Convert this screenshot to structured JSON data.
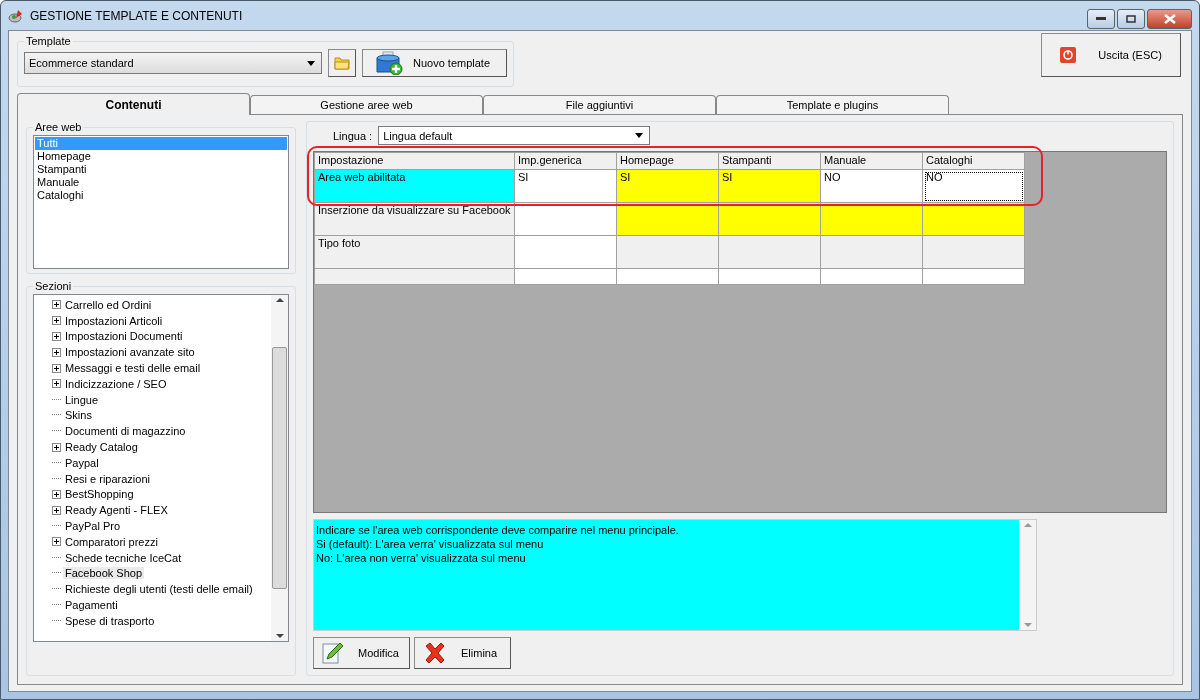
{
  "window": {
    "title": "GESTIONE TEMPLATE E CONTENUTI"
  },
  "template": {
    "label": "Template",
    "value": "Ecommerce standard",
    "new_button": "Nuovo template"
  },
  "exit_button": "Uscita (ESC)",
  "tabs": [
    {
      "label": "Contenuti",
      "selected": true
    },
    {
      "label": "Gestione aree web",
      "selected": false
    },
    {
      "label": "File aggiuntivi",
      "selected": false
    },
    {
      "label": "Template e plugins",
      "selected": false
    }
  ],
  "aree_web": {
    "label": "Aree web",
    "items": [
      {
        "label": "Tutti",
        "selected": true
      },
      {
        "label": "Homepage",
        "selected": false
      },
      {
        "label": "Stampanti",
        "selected": false
      },
      {
        "label": "Manuale",
        "selected": false
      },
      {
        "label": "Cataloghi",
        "selected": false
      }
    ]
  },
  "sezioni": {
    "label": "Sezioni",
    "items": [
      {
        "label": "Carrello ed Ordini",
        "expandable": true,
        "selected": false
      },
      {
        "label": "Impostazioni Articoli",
        "expandable": true,
        "selected": false
      },
      {
        "label": "Impostazioni Documenti",
        "expandable": true,
        "selected": false
      },
      {
        "label": "Impostazioni avanzate sito",
        "expandable": true,
        "selected": false
      },
      {
        "label": "Messaggi e testi delle email",
        "expandable": true,
        "selected": false
      },
      {
        "label": "Indicizzazione / SEO",
        "expandable": true,
        "selected": false
      },
      {
        "label": "Lingue",
        "expandable": false,
        "selected": false
      },
      {
        "label": "Skins",
        "expandable": false,
        "selected": false
      },
      {
        "label": "Documenti di magazzino",
        "expandable": false,
        "selected": false
      },
      {
        "label": "Ready Catalog",
        "expandable": true,
        "selected": false
      },
      {
        "label": "Paypal",
        "expandable": false,
        "selected": false
      },
      {
        "label": "Resi e riparazioni",
        "expandable": false,
        "selected": false
      },
      {
        "label": "BestShopping",
        "expandable": true,
        "selected": false
      },
      {
        "label": "Ready Agenti - FLEX",
        "expandable": true,
        "selected": false
      },
      {
        "label": "PayPal Pro",
        "expandable": false,
        "selected": false
      },
      {
        "label": "Comparatori prezzi",
        "expandable": true,
        "selected": false
      },
      {
        "label": "Schede tecniche IceCat",
        "expandable": false,
        "selected": false
      },
      {
        "label": "Facebook Shop",
        "expandable": false,
        "selected": true
      },
      {
        "label": "Richieste degli utenti (testi delle email)",
        "expandable": false,
        "selected": false
      },
      {
        "label": "Pagamenti",
        "expandable": false,
        "selected": false
      },
      {
        "label": "Spese di trasporto",
        "expandable": false,
        "selected": false
      }
    ]
  },
  "lingua": {
    "label": "Lingua :",
    "value": "Lingua default"
  },
  "grid": {
    "columns": [
      "Impostazione",
      "Imp.generica",
      "Homepage",
      "Stampanti",
      "Manuale",
      "Cataloghi"
    ],
    "rows": [
      {
        "cells": [
          {
            "text": "Area web abilitata",
            "color": "#00ffff",
            "focused": false
          },
          {
            "text": "SI",
            "color": "#ffffff",
            "focused": false
          },
          {
            "text": "SI",
            "color": "#ffff00",
            "focused": false
          },
          {
            "text": "SI",
            "color": "#ffff00",
            "focused": false
          },
          {
            "text": "NO",
            "color": "#ffffff",
            "focused": false
          },
          {
            "text": "NO",
            "color": "#ffffff",
            "focused": true
          }
        ]
      },
      {
        "cells": [
          {
            "text": "Inserzione da visualizzare su Facebook",
            "color": "#f0f0f0",
            "focused": false
          },
          {
            "text": "",
            "color": "#ffffff",
            "focused": false
          },
          {
            "text": "",
            "color": "#ffff00",
            "focused": false
          },
          {
            "text": "",
            "color": "#ffff00",
            "focused": false
          },
          {
            "text": "",
            "color": "#ffff00",
            "focused": false
          },
          {
            "text": "",
            "color": "#ffff00",
            "focused": false
          }
        ]
      },
      {
        "cells": [
          {
            "text": "Tipo foto",
            "color": "#f0f0f0",
            "focused": false
          },
          {
            "text": "",
            "color": "#ffffff",
            "focused": false
          },
          {
            "text": "",
            "color": "#f0f0f0",
            "focused": false
          },
          {
            "text": "",
            "color": "#f0f0f0",
            "focused": false
          },
          {
            "text": "",
            "color": "#f0f0f0",
            "focused": false
          },
          {
            "text": "",
            "color": "#f0f0f0",
            "focused": false
          }
        ]
      },
      {
        "kind": "blank",
        "cells": [
          {
            "text": "",
            "color": "#f0f0f0",
            "focused": false
          },
          {
            "text": "",
            "color": "#ffffff",
            "focused": false
          },
          {
            "text": "",
            "color": "#ffffff",
            "focused": false
          },
          {
            "text": "",
            "color": "#ffffff",
            "focused": false
          },
          {
            "text": "",
            "color": "#ffffff",
            "focused": false
          },
          {
            "text": "",
            "color": "#ffffff",
            "focused": false
          }
        ]
      }
    ]
  },
  "description": [
    "Indicare se l'area web corrispondente deve comparire nel menu principale.",
    "Si (default): L'area verra' visualizzata sul menu",
    "No: L'area non verra' visualizzata sul menu"
  ],
  "buttons": [
    {
      "label": "Modifica",
      "kind": "edit"
    },
    {
      "label": "Elimina",
      "kind": "delete"
    }
  ]
}
